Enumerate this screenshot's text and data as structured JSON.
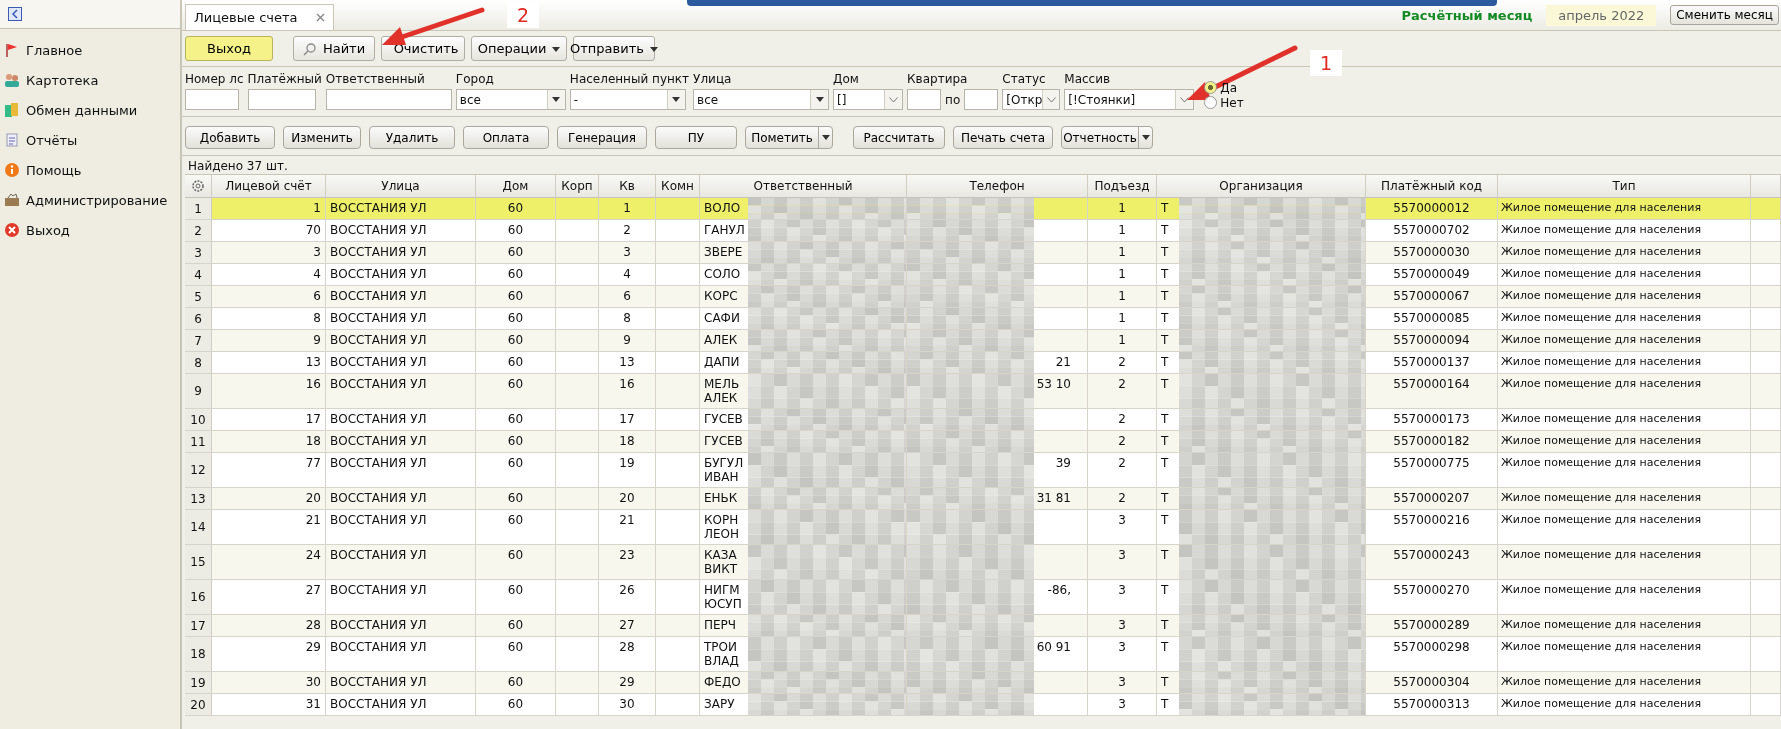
{
  "sidebar": {
    "items": [
      {
        "label": "Главное"
      },
      {
        "label": "Картотека"
      },
      {
        "label": "Обмен данными"
      },
      {
        "label": "Отчёты"
      },
      {
        "label": "Помощь"
      },
      {
        "label": "Администрирование"
      },
      {
        "label": "Выход"
      }
    ]
  },
  "tab": {
    "title": "Лицевые счета"
  },
  "period": {
    "label": "Расчётный месяц",
    "value": "апрель 2022",
    "button": "Сменить месяц"
  },
  "toolbar": [
    {
      "label": "Выход",
      "kind": "primary"
    },
    {
      "label": "Найти",
      "kind": "search"
    },
    {
      "label": "Очистить",
      "kind": "clear"
    },
    {
      "label": "Операции",
      "kind": "dropdown"
    },
    {
      "label": "Отправить",
      "kind": "dropdown"
    }
  ],
  "filters": [
    {
      "label": "Номер лс",
      "kind": "text"
    },
    {
      "label": "Платёжный",
      "kind": "text"
    },
    {
      "label": "Ответственный",
      "kind": "text"
    },
    {
      "label": "Город",
      "kind": "combo",
      "value": "все"
    },
    {
      "label": "Населенный пункт",
      "kind": "combo",
      "value": "-"
    },
    {
      "label": "Улица",
      "kind": "combo",
      "value": "все"
    },
    {
      "label": "Дом",
      "kind": "select",
      "value": "[]"
    },
    {
      "label": "Квартира",
      "kind": "range",
      "separator": "по"
    },
    {
      "label": "Статус",
      "kind": "select",
      "value": "[Откр"
    },
    {
      "label": "Массив",
      "kind": "select",
      "value": "[!Стоянки]"
    }
  ],
  "radio": [
    {
      "label": "Да",
      "selected": true
    },
    {
      "label": "Нет",
      "selected": false
    }
  ],
  "actions": [
    {
      "label": "Добавить",
      "kind": "plain"
    },
    {
      "label": "Изменить",
      "kind": "plain"
    },
    {
      "label": "Удалить",
      "kind": "plain"
    },
    {
      "label": "Оплата",
      "kind": "plain"
    },
    {
      "label": "Генерация",
      "kind": "plain"
    },
    {
      "label": "ПУ",
      "kind": "plain"
    },
    {
      "label": "Пометить",
      "kind": "split"
    },
    {
      "label": "Рассчитать",
      "kind": "plain"
    },
    {
      "label": "Печать счета",
      "kind": "plain"
    },
    {
      "label": "Отчетность",
      "kind": "split"
    }
  ],
  "found": "Найдено 37 шт.",
  "table": {
    "columns": [
      "Лицевой счёт",
      "Улица",
      "Дом",
      "Корп",
      "Кв",
      "Комн",
      "Ответственный",
      "Телефон",
      "Подъезд",
      "Организация",
      "Платёжный код",
      "Тип"
    ],
    "rows": [
      {
        "num": "1",
        "account": "1",
        "street": "ВОССТАНИЯ УЛ",
        "house": "60",
        "apt": "1",
        "responsible": [
          "ВОЛО"
        ],
        "entrance": "1",
        "org": "Т",
        "code": "5570000012",
        "type": "Жилое помещение для населения",
        "selected": true
      },
      {
        "num": "2",
        "account": "70",
        "street": "ВОССТАНИЯ УЛ",
        "house": "60",
        "apt": "2",
        "responsible": [
          "ГАНУЛ"
        ],
        "entrance": "1",
        "org": "Т",
        "code": "5570000702",
        "type": "Жилое помещение для населения",
        "selected": false
      },
      {
        "num": "3",
        "account": "3",
        "street": "ВОССТАНИЯ УЛ",
        "house": "60",
        "apt": "3",
        "responsible": [
          "ЗВЕРЕ"
        ],
        "entrance": "1",
        "org": "Т",
        "code": "5570000030",
        "type": "Жилое помещение для населения",
        "selected": false
      },
      {
        "num": "4",
        "account": "4",
        "street": "ВОССТАНИЯ УЛ",
        "house": "60",
        "apt": "4",
        "responsible": [
          "СОЛО"
        ],
        "entrance": "1",
        "org": "Т",
        "code": "5570000049",
        "type": "Жилое помещение для населения",
        "selected": false
      },
      {
        "num": "5",
        "account": "6",
        "street": "ВОССТАНИЯ УЛ",
        "house": "60",
        "apt": "6",
        "responsible": [
          "КОРС"
        ],
        "entrance": "1",
        "org": "Т",
        "code": "5570000067",
        "type": "Жилое помещение для населения",
        "selected": false
      },
      {
        "num": "6",
        "account": "8",
        "street": "ВОССТАНИЯ УЛ",
        "house": "60",
        "apt": "8",
        "responsible": [
          "САФИ"
        ],
        "entrance": "1",
        "org": "Т",
        "code": "5570000085",
        "type": "Жилое помещение для населения",
        "selected": false
      },
      {
        "num": "7",
        "account": "9",
        "street": "ВОССТАНИЯ УЛ",
        "house": "60",
        "apt": "9",
        "responsible": [
          "АЛЕК"
        ],
        "entrance": "1",
        "org": "Т",
        "code": "5570000094",
        "type": "Жилое помещение для населения",
        "selected": false
      },
      {
        "num": "8",
        "account": "13",
        "street": "ВОССТАНИЯ УЛ",
        "house": "60",
        "apt": "13",
        "responsible": [
          "ДАПИ"
        ],
        "phone": "21",
        "entrance": "2",
        "org": "Т",
        "code": "5570000137",
        "type": "Жилое помещение для населения",
        "selected": false
      },
      {
        "num": "9",
        "account": "16",
        "street": "ВОССТАНИЯ УЛ",
        "house": "60",
        "apt": "16",
        "responsible": [
          "МЕЛЬ",
          "АЛЕК"
        ],
        "phone": "53 10",
        "entrance": "2",
        "org": "Т",
        "code": "5570000164",
        "type": "Жилое помещение для населения",
        "selected": false
      },
      {
        "num": "10",
        "account": "17",
        "street": "ВОССТАНИЯ УЛ",
        "house": "60",
        "apt": "17",
        "responsible": [
          "ГУСЕВ"
        ],
        "entrance": "2",
        "org": "Т",
        "code": "5570000173",
        "type": "Жилое помещение для населения",
        "selected": false
      },
      {
        "num": "11",
        "account": "18",
        "street": "ВОССТАНИЯ УЛ",
        "house": "60",
        "apt": "18",
        "responsible": [
          "ГУСЕВ"
        ],
        "entrance": "2",
        "org": "Т",
        "code": "5570000182",
        "type": "Жилое помещение для населения",
        "selected": false
      },
      {
        "num": "12",
        "account": "77",
        "street": "ВОССТАНИЯ УЛ",
        "house": "60",
        "apt": "19",
        "responsible": [
          "БУГУЛ",
          "ИВАН"
        ],
        "phone": "39",
        "entrance": "2",
        "org": "Т",
        "code": "5570000775",
        "type": "Жилое помещение для населения",
        "selected": false
      },
      {
        "num": "13",
        "account": "20",
        "street": "ВОССТАНИЯ УЛ",
        "house": "60",
        "apt": "20",
        "responsible": [
          "ЕНЬК"
        ],
        "phone": "31 81",
        "entrance": "2",
        "org": "Т",
        "code": "5570000207",
        "type": "Жилое помещение для населения",
        "selected": false
      },
      {
        "num": "14",
        "account": "21",
        "street": "ВОССТАНИЯ УЛ",
        "house": "60",
        "apt": "21",
        "responsible": [
          "КОРН",
          "ЛЕОН"
        ],
        "entrance": "3",
        "org": "Т",
        "code": "5570000216",
        "type": "Жилое помещение для населения",
        "selected": false
      },
      {
        "num": "15",
        "account": "24",
        "street": "ВОССТАНИЯ УЛ",
        "house": "60",
        "apt": "23",
        "responsible": [
          "КАЗА",
          "ВИКТ"
        ],
        "entrance": "3",
        "org": "Т",
        "code": "5570000243",
        "type": "Жилое помещение для населения",
        "selected": false
      },
      {
        "num": "16",
        "account": "27",
        "street": "ВОССТАНИЯ УЛ",
        "house": "60",
        "apt": "26",
        "responsible": [
          "НИГМ",
          "ЮСУП"
        ],
        "phone": "-86,",
        "entrance": "3",
        "org": "Т",
        "code": "5570000270",
        "type": "Жилое помещение для населения",
        "selected": false
      },
      {
        "num": "17",
        "account": "28",
        "street": "ВОССТАНИЯ УЛ",
        "house": "60",
        "apt": "27",
        "responsible": [
          "ПЕРЧ"
        ],
        "entrance": "3",
        "org": "Т",
        "code": "5570000289",
        "type": "Жилое помещение для населения",
        "selected": false
      },
      {
        "num": "18",
        "account": "29",
        "street": "ВОССТАНИЯ УЛ",
        "house": "60",
        "apt": "28",
        "responsible": [
          "ТРОИ",
          "ВЛАД"
        ],
        "phone": "60 91",
        "entrance": "3",
        "org": "Т",
        "code": "5570000298",
        "type": "Жилое помещение для населения",
        "selected": false
      },
      {
        "num": "19",
        "account": "30",
        "street": "ВОССТАНИЯ УЛ",
        "house": "60",
        "apt": "29",
        "responsible": [
          "ФЕДО"
        ],
        "entrance": "3",
        "org": "Т",
        "code": "5570000304",
        "type": "Жилое помещение для населения",
        "selected": false
      },
      {
        "num": "20",
        "account": "31",
        "street": "ВОССТАНИЯ УЛ",
        "house": "60",
        "apt": "30",
        "responsible": [
          "ЗАРУ"
        ],
        "entrance": "3",
        "org": "Т",
        "code": "5570000313",
        "type": "Жилое помещение для населения",
        "selected": false
      }
    ]
  },
  "annotations": [
    {
      "label": "2"
    },
    {
      "label": "1"
    }
  ]
}
